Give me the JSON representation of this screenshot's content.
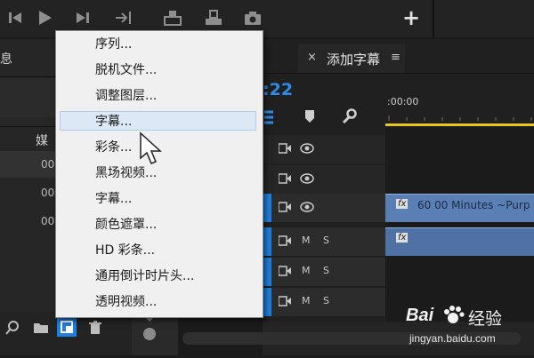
{
  "transport": {
    "play_icon": "play-icon",
    "step_forward_icon": "step-forward-icon",
    "add_label": "+"
  },
  "left_panel": {
    "title_fragment": "息",
    "column_fragment": "媒",
    "rows": [
      "00",
      "00",
      "00"
    ]
  },
  "timeline": {
    "tab_close": "×",
    "tab_label": "添加字幕",
    "tab_menu": "≡",
    "timecode_fragment": ":22",
    "ruler_time": ":00:00",
    "clip_label": "60 00 Minutes ~Purp",
    "clip_fx": "fx",
    "tracks": {
      "m_label": "M",
      "s_label": "S"
    }
  },
  "menu": {
    "items": [
      "序列...",
      "脱机文件...",
      "调整图层...",
      "字幕...",
      "彩条...",
      "黑场视频...",
      "字幕...",
      "颜色遮罩...",
      "HD 彩条...",
      "通用倒计时片头...",
      "透明视频..."
    ],
    "highlighted_index": 3
  },
  "watermark": {
    "brand": "Bai",
    "brand_suffix": "经验",
    "url": "jingyan.baidu.com"
  },
  "colors": {
    "clip": "#5a7fb5",
    "accent_blue": "#2d8ceb",
    "ruler_yellow": "#e8c61e"
  }
}
